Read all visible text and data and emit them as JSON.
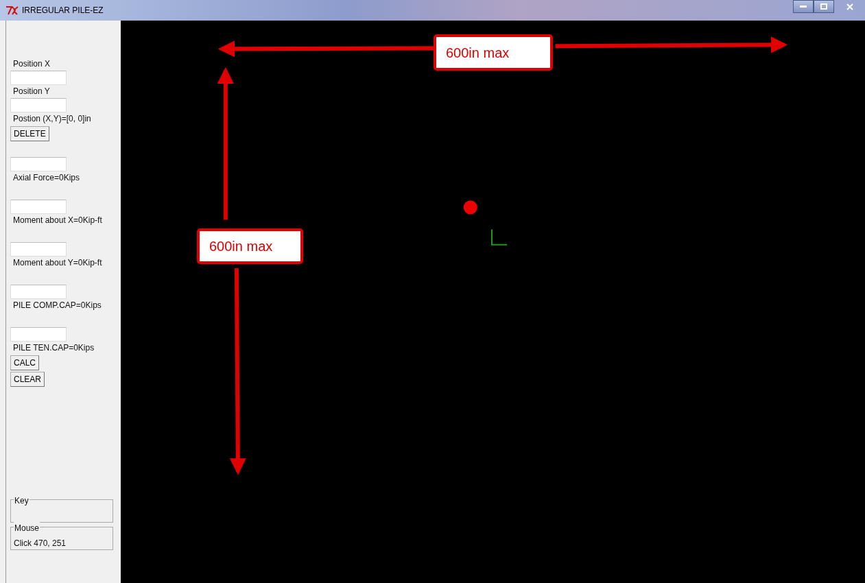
{
  "window": {
    "title": "IRREGULAR PILE-EZ"
  },
  "panel": {
    "groups": [
      {
        "items": [
          {
            "kind": "label",
            "text": "Position X"
          },
          {
            "kind": "input"
          },
          {
            "kind": "label",
            "text": "Position Y"
          },
          {
            "kind": "input"
          },
          {
            "kind": "label",
            "text": "Postion (X,Y)=[0, 0]in"
          },
          {
            "kind": "button",
            "text": "DELETE"
          }
        ]
      },
      {
        "items": [
          {
            "kind": "input"
          },
          {
            "kind": "label",
            "text": "Axial Force=0Kips"
          }
        ]
      },
      {
        "items": [
          {
            "kind": "input"
          },
          {
            "kind": "label",
            "text": "Moment about X=0Kip-ft"
          }
        ]
      },
      {
        "items": [
          {
            "kind": "input"
          },
          {
            "kind": "label",
            "text": "Moment about Y=0Kip-ft"
          }
        ]
      },
      {
        "items": [
          {
            "kind": "input"
          },
          {
            "kind": "label",
            "text": "PILE COMP.CAP=0Kips"
          }
        ]
      },
      {
        "items": [
          {
            "kind": "input"
          },
          {
            "kind": "label",
            "text": "PILE TEN.CAP=0Kips"
          },
          {
            "kind": "button",
            "text": "CALC"
          },
          {
            "kind": "button",
            "text": "CLEAR"
          }
        ]
      }
    ],
    "frames": [
      {
        "legend": "Key"
      },
      {
        "legend": "Mouse",
        "text": "Click 470, 251"
      }
    ]
  },
  "canvas": {
    "callouts": [
      {
        "text": "600in max"
      },
      {
        "text": "600in max"
      }
    ]
  }
}
